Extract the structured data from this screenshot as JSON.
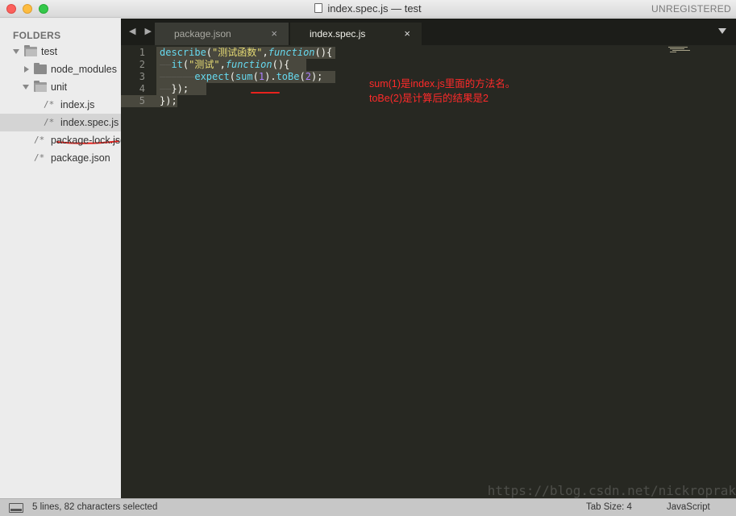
{
  "window": {
    "title": "index.spec.js — test",
    "unregistered_label": "UNREGISTERED"
  },
  "sidebar": {
    "header": "FOLDERS",
    "tree": [
      {
        "label": "test",
        "kind": "folder",
        "expanded": true
      },
      {
        "label": "node_modules",
        "kind": "folder",
        "expanded": false
      },
      {
        "label": "unit",
        "kind": "folder",
        "expanded": true
      },
      {
        "label": "index.js",
        "kind": "file"
      },
      {
        "label": "index.spec.js",
        "kind": "file",
        "selected": true
      },
      {
        "label": "package-lock.json",
        "kind": "file"
      },
      {
        "label": "package.json",
        "kind": "file"
      }
    ],
    "file_glyph": "/*"
  },
  "tabs": [
    {
      "label": "package.json",
      "active": false,
      "close": "×"
    },
    {
      "label": "index.spec.js",
      "active": true,
      "close": "×"
    }
  ],
  "nav_arrows": "◀ ▶",
  "editor": {
    "line_numbers": [
      "1",
      "2",
      "3",
      "4",
      "5"
    ],
    "lines": [
      {
        "tokens": [
          [
            "fn",
            "describe"
          ],
          [
            "p",
            "("
          ],
          [
            "str",
            "\"测试函数\""
          ],
          [
            "p",
            ","
          ],
          [
            "kw",
            "function"
          ],
          [
            "p",
            "(){"
          ]
        ]
      },
      {
        "tokens": [
          [
            "guide",
            "——"
          ],
          [
            "fn",
            "it"
          ],
          [
            "p",
            "("
          ],
          [
            "str",
            "\"测试\""
          ],
          [
            "p",
            ","
          ],
          [
            "kw",
            "function"
          ],
          [
            "p",
            "(){"
          ]
        ]
      },
      {
        "tokens": [
          [
            "guide",
            "——————"
          ],
          [
            "fn",
            "expect"
          ],
          [
            "p",
            "("
          ],
          [
            "fn",
            "sum"
          ],
          [
            "p",
            "("
          ],
          [
            "num",
            "1"
          ],
          [
            "p",
            ")."
          ],
          [
            "fn",
            "toBe"
          ],
          [
            "p",
            "("
          ],
          [
            "num",
            "2"
          ],
          [
            "p",
            ");"
          ]
        ]
      },
      {
        "tokens": [
          [
            "guide",
            "——"
          ],
          [
            "p",
            "});"
          ]
        ]
      },
      {
        "tokens": [
          [
            "p",
            "});"
          ]
        ]
      }
    ],
    "annotation_line1": "sum(1)是index.js里面的方法名。",
    "annotation_line2": "toBe(2)是计算后的结果是2",
    "annotation_color": "#ff2a2a",
    "watermark": "https://blog.csdn.net/nickroprak"
  },
  "statusbar": {
    "selection": "5 lines, 82 characters selected",
    "tab_size": "Tab Size: 4",
    "syntax": "JavaScript"
  },
  "colors": {
    "editor_bg": "#272822",
    "function": "#66d9ef",
    "string": "#e6db74",
    "number": "#ae81ff",
    "selection": "#49483e"
  }
}
